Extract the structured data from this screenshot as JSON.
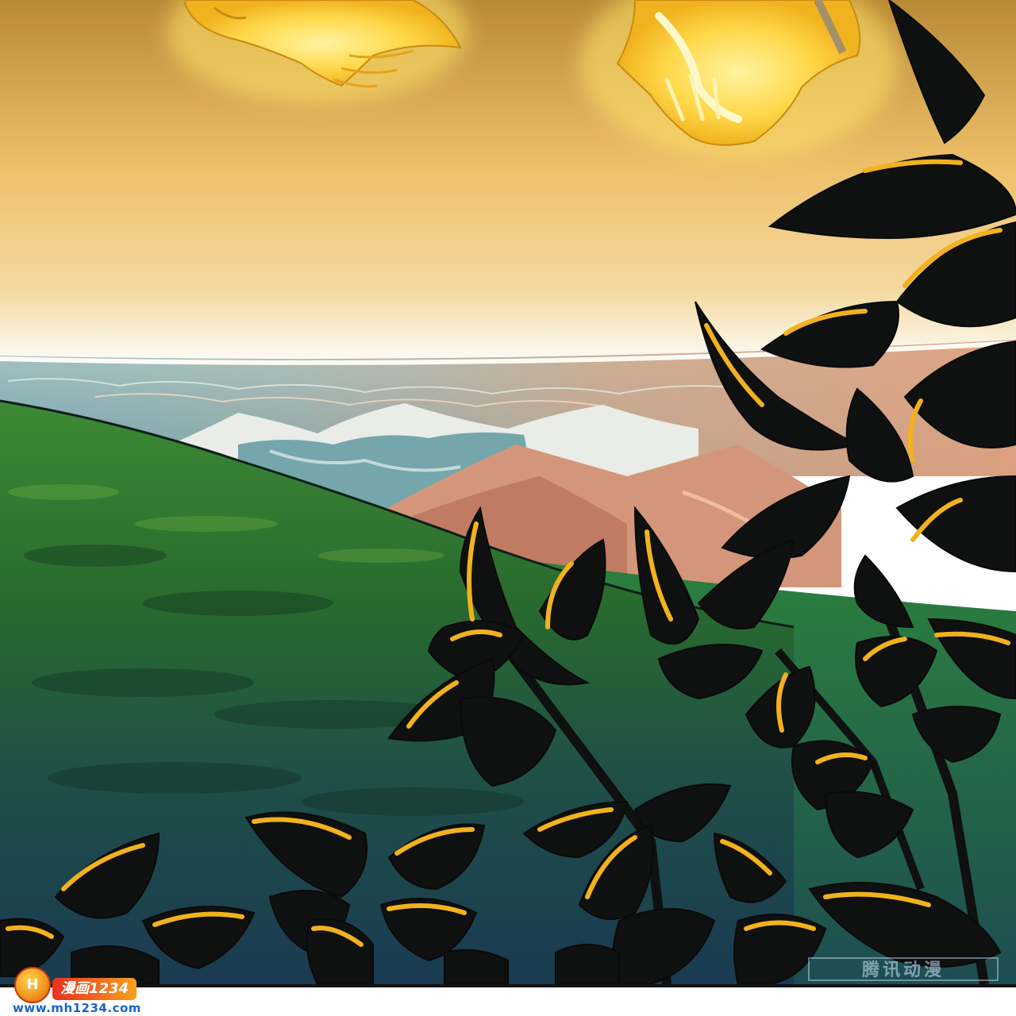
{
  "watermark": {
    "logo_text": "H",
    "badge_text": "漫画1234",
    "url": "www.mh1234.com",
    "corner_text": "腾讯动漫"
  },
  "colors": {
    "sky_top": "#c99a3e",
    "sky_mid": "#f0c876",
    "horizon_glow": "#f6f3e8",
    "sea": "#8fb4b8",
    "hill_green": "#2c7a2c",
    "hill_dark": "#1e3f4c",
    "mountain_warm": "#d99a78",
    "leaf_fill": "#0f1010",
    "leaf_highlight": "#f2b21e",
    "creature_glow": "#ffe14a"
  },
  "scene": {
    "subjects": [
      "glowing-creature-heads",
      "sea-horizon",
      "mountain-range",
      "green-hills",
      "silhouette-foliage"
    ]
  }
}
